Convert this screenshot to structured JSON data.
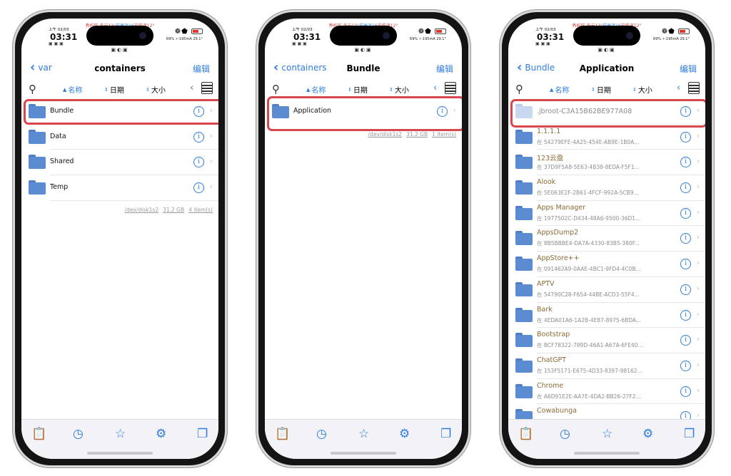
{
  "status": {
    "weather_red": "秀屿区 多云13°",
    "weather_blue": "最高温16",
    "weather_red2": "最低温12°",
    "ampm": "上午",
    "date": "02/03",
    "time": "03:31",
    "stats": "69% ⚡-195mA",
    "temp": "29.1°"
  },
  "icons": {
    "search": "magnifier-icon",
    "sort_asc": "sort-ascending-icon",
    "sort_none": "sort-toggle-icon",
    "grid": "grid-view-icon",
    "info": "info-circle-icon",
    "chevron": "chevron-right-icon",
    "tabs": [
      "clipboard-icon",
      "clock-icon",
      "star-icon",
      "gear-icon",
      "windows-icon"
    ]
  },
  "colors": {
    "accent": "#2f7de1",
    "highlight": "#d7474b",
    "folder": "#5b8bd0"
  },
  "sort_labels": {
    "name": "名称",
    "date": "日期",
    "size": "大小"
  },
  "screens": [
    {
      "back_label": "var",
      "title": "containers",
      "edit_label": "编辑",
      "items": [
        {
          "name": "Bundle"
        },
        {
          "name": "Data"
        },
        {
          "name": "Shared"
        },
        {
          "name": "Temp"
        }
      ],
      "footer": {
        "disk": "/dev/disk1s2",
        "size": "31.2 GB",
        "count": "4 item(s)"
      }
    },
    {
      "back_label": "containers",
      "title": "Bundle",
      "edit_label": "编辑",
      "items": [
        {
          "name": "Application"
        }
      ],
      "footer": {
        "disk": "/dev/disk1s2",
        "size": "31.2 GB",
        "count": "1 item(s)"
      }
    },
    {
      "back_label": "Bundle",
      "title": "Application",
      "edit_label": "编辑",
      "items": [
        {
          "name": ".jbroot-C3A15B62BE977A08",
          "sub": ""
        },
        {
          "name": "1.1.1.1",
          "sub": "在 54279EFE-4A25-454E-AB9E-1B0A..."
        },
        {
          "name": "123云盘",
          "sub": "在 37D9F5A8-5E63-4B38-8EDA-F5F1..."
        },
        {
          "name": "Alook",
          "sub": "在 5E063E2F-2B61-4FCF-992A-5CB9..."
        },
        {
          "name": "Apps Manager",
          "sub": "在 1977502C-D434-48A6-9500-36D1..."
        },
        {
          "name": "AppsDump2",
          "sub": "在 8B5BBBE4-DA7A-4330-83B5-380F..."
        },
        {
          "name": "AppStore++",
          "sub": "在 091462A9-0AAE-4BC1-9FD4-4C0B..."
        },
        {
          "name": "APTV",
          "sub": "在 54790C28-F654-44BE-ACD3-55F4..."
        },
        {
          "name": "Bark",
          "sub": "在 4EDA01A6-1A2B-4E87-8975-6BDA..."
        },
        {
          "name": "Bootstrap",
          "sub": "在 BCF78322-789D-46A1-A67A-6FE40..."
        },
        {
          "name": "ChatGPT",
          "sub": "在 153F5171-E675-4D33-8397-98162..."
        },
        {
          "name": "Chrome",
          "sub": "在 A6D91E2E-AA7E-4DA2-BB26-27F2..."
        },
        {
          "name": "Cowabunga",
          "sub": ""
        }
      ]
    }
  ]
}
